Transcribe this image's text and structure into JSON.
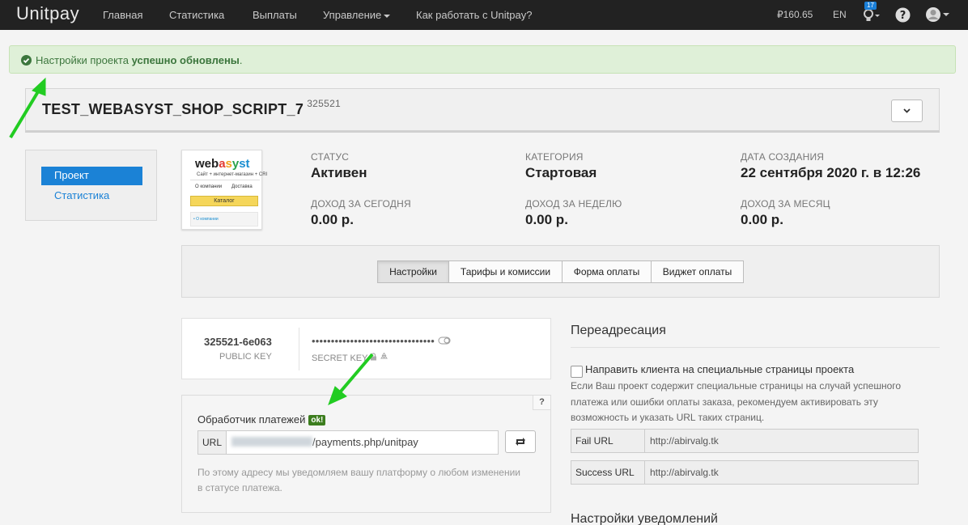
{
  "navbar": {
    "brand": "Unitpay",
    "links": [
      "Главная",
      "Статистика",
      "Выплаты",
      "Управление",
      "Как работать с Unitpay?"
    ],
    "balance": "₽160.65",
    "lang": "EN",
    "notifications": "17"
  },
  "alert": {
    "text_before": "Настройки проекта ",
    "text_bold": "успешно обновлены",
    "text_after": "."
  },
  "project": {
    "title": "TEST_WEBASYST_SHOP_SCRIPT_7",
    "id": "325521"
  },
  "side_menu": {
    "items": [
      "Проект",
      "Статистика"
    ]
  },
  "logo": {
    "wordmark_parts": [
      "web",
      "a",
      "s",
      "y",
      "st"
    ],
    "subtitle": "Сайт + интернет-магазин + CRI",
    "nav_left": "О компании",
    "nav_right": "Доставка",
    "button": "Каталог",
    "footer": "• О компании"
  },
  "stats": [
    {
      "label": "Статус",
      "value": "Активен"
    },
    {
      "label": "Категория",
      "value": "Стартовая"
    },
    {
      "label": "Дата создания",
      "value": "22 сентября 2020 г. в 12:26"
    },
    {
      "label": "Доход за сегодня",
      "value": "0.00 р."
    },
    {
      "label": "Доход за неделю",
      "value": "0.00 р."
    },
    {
      "label": "Доход за месяц",
      "value": "0.00 р."
    }
  ],
  "tabs": [
    "Настройки",
    "Тарифы и комиссии",
    "Форма оплаты",
    "Виджет оплаты"
  ],
  "keys": {
    "public_key": "325521-6e063",
    "public_label": "Public key",
    "secret_key": "••••••••••••••••••••••••••••••••",
    "secret_label": "Secret key"
  },
  "handler": {
    "label": "Обработчик платежей",
    "badge": "ok!",
    "help": "?",
    "url_addon": "URL",
    "url_value": "/payments.php/unitpay",
    "hint": "По этому адресу мы уведомляем вашу платформу о любом изменении в статусе платежа."
  },
  "redirect": {
    "title": "Переадресация",
    "checkbox_label": "Направить клиента на специальные страницы проекта",
    "hint": "Если Ваш проект содержит специальные страницы на случай успешного платежа или ошибки оплаты заказа, рекомендуем активировать эту возможность и указать URL таких страниц.",
    "fail_label": "Fail URL",
    "fail_value": "http://abirvalg.tk",
    "success_label": "Success URL",
    "success_value": "http://abirvalg.tk"
  },
  "notifications_section": {
    "title": "Настройки уведомлений"
  },
  "colors": {
    "primary": "#1b82d6",
    "navbar": "#222222",
    "alert_bg": "#dff0d8",
    "ok_badge": "#3c7d1e",
    "arrow": "#22cc22"
  }
}
